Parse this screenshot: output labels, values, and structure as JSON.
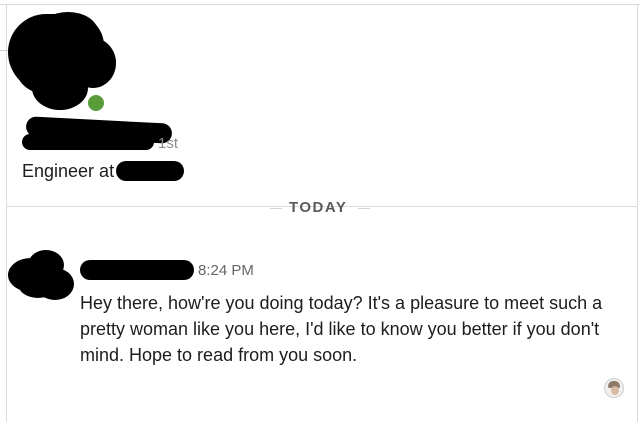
{
  "profile": {
    "connection_degree": "1st",
    "headline_prefix": "Engineer at",
    "presence_color": "#5a9b3a",
    "name": "",
    "company": ""
  },
  "conversation": {
    "date_separator": "TODAY",
    "messages": [
      {
        "sender": "",
        "time": "8:24 PM",
        "text": "Hey there, how're you doing today? It's a pleasure to meet such a pretty woman like you here, I'd like to know you better if you don't mind. Hope to read from you soon."
      }
    ],
    "read_receipt": {
      "icon": "seen-avatar-icon"
    }
  }
}
